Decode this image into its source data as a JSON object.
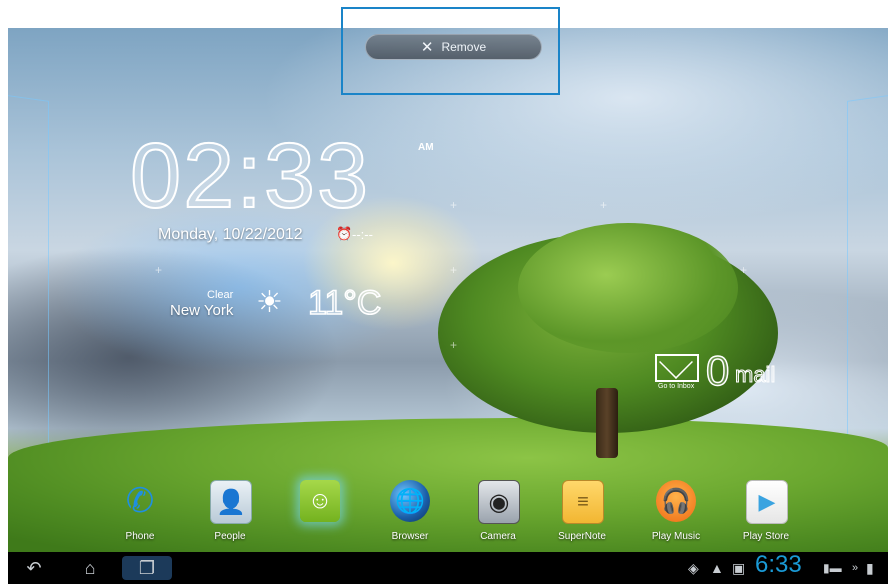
{
  "top_action": {
    "remove_label": "Remove"
  },
  "clock_widget": {
    "time": "02:33",
    "ampm": "AM",
    "date": "Monday, 10/22/2012",
    "alarm": "--:--"
  },
  "weather_widget": {
    "condition": "Clear",
    "city": "New York",
    "temperature": "11°C"
  },
  "mail_widget": {
    "subtitle": "Go to Inbox",
    "count": "0",
    "label": "mail"
  },
  "dock": {
    "items": [
      {
        "label": "Phone",
        "icon": "phone-icon"
      },
      {
        "label": "People",
        "icon": "contacts-icon"
      },
      {
        "label": "",
        "icon": "messaging-icon"
      },
      {
        "label": "Browser",
        "icon": "globe-icon"
      },
      {
        "label": "Camera",
        "icon": "camera-icon"
      },
      {
        "label": "SuperNote",
        "icon": "notebook-icon"
      },
      {
        "label": "Play Music",
        "icon": "headphones-icon"
      },
      {
        "label": "Play Store",
        "icon": "shopping-bag-icon"
      }
    ]
  },
  "status_bar": {
    "time": "6:33"
  },
  "colors": {
    "highlight_frame": "#1a84c8",
    "status_time": "#1a9ad6",
    "navbar": "#000000"
  }
}
